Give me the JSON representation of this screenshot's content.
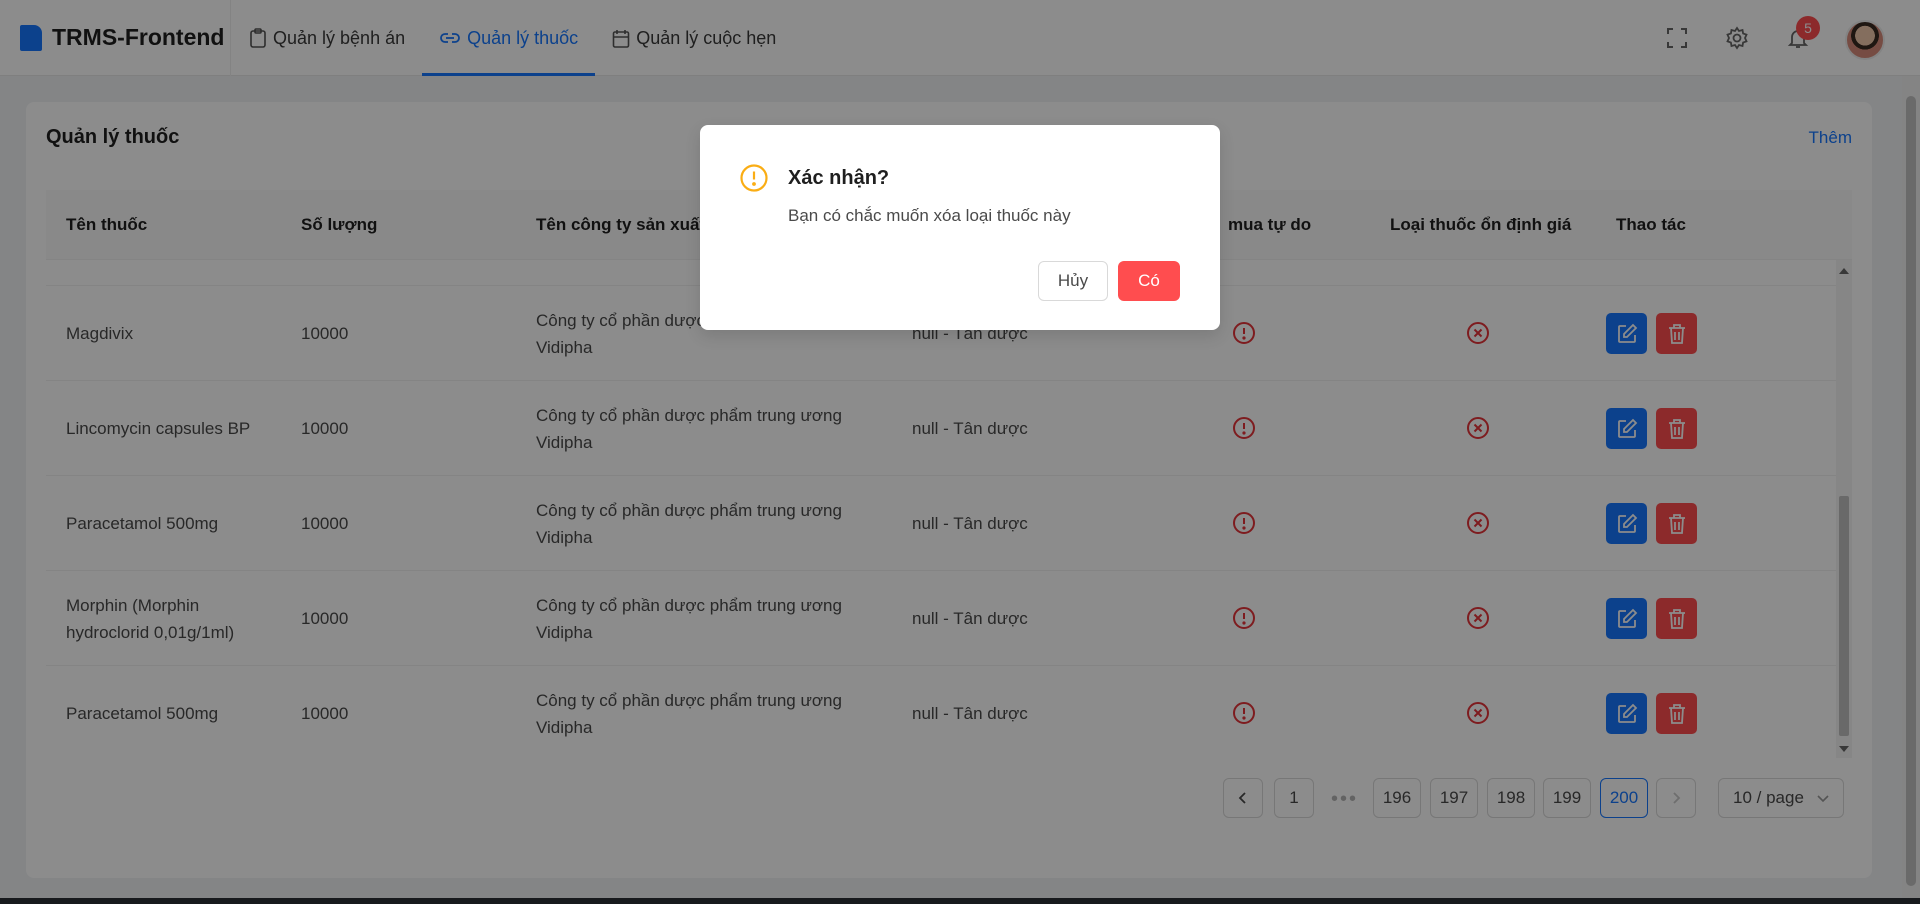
{
  "app": {
    "title": "TRMS-Frontend"
  },
  "nav": [
    {
      "label": "Quản lý bệnh án",
      "icon": "clipboard-icon",
      "active": false
    },
    {
      "label": "Quản lý thuốc",
      "icon": "link-icon",
      "active": true
    },
    {
      "label": "Quản lý cuộc hẹn",
      "icon": "calendar-icon",
      "active": false
    }
  ],
  "header_icons": [
    "fullscreen-icon",
    "settings-icon",
    "bell-icon"
  ],
  "notifications": {
    "count": "5"
  },
  "card": {
    "title": "Quản lý thuốc",
    "add_label": "Thêm"
  },
  "table": {
    "columns": [
      "Tên thuốc",
      "Số lượng",
      "Tên công ty sản xuất",
      "",
      "mua tự do",
      "Loại thuốc ổn định giá",
      "Thao tác"
    ],
    "rows": [
      {
        "name": "Magdivix",
        "quantity": "10000",
        "company": "Công ty cổ phần dược",
        "company2": "Vidipha",
        "type": "null - Tân dược"
      },
      {
        "name": "Lincomycin capsules BP",
        "quantity": "10000",
        "company": "Công ty cổ phần dược phẩm trung ương",
        "company2": "Vidipha",
        "type": "null - Tân dược"
      },
      {
        "name": "Paracetamol 500mg",
        "quantity": "10000",
        "company": "Công ty cổ phần dược phẩm trung ương",
        "company2": "Vidipha",
        "type": "null - Tân dược"
      },
      {
        "name": "Morphin (Morphin",
        "name2": "hydroclorid 0,01g/1ml)",
        "quantity": "10000",
        "company": "Công ty cổ phần dược phẩm trung ương",
        "company2": "Vidipha",
        "type": "null - Tân dược"
      },
      {
        "name": "Paracetamol 500mg",
        "quantity": "10000",
        "company": "Công ty cổ phần dược phẩm trung ương",
        "company2": "Vidipha",
        "type": "null - Tân dược"
      }
    ]
  },
  "pagination": {
    "pages": [
      "1",
      "196",
      "197",
      "198",
      "199",
      "200"
    ],
    "current": "200",
    "ellipsis": "•••",
    "page_size": "10 / page"
  },
  "modal": {
    "title": "Xác nhận?",
    "content": "Bạn có chắc muốn xóa loại thuốc này",
    "cancel_label": "Hủy",
    "ok_label": "Có"
  },
  "colors": {
    "primary": "#1677ff",
    "danger": "#ff4d4f",
    "warning": "#faad14"
  }
}
